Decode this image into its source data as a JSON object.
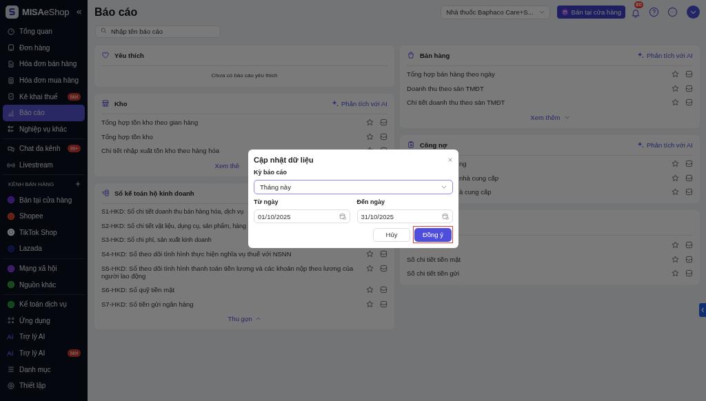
{
  "sidebar": {
    "logo": "**MISA**eShop",
    "sections": [
      {
        "items": [
          {
            "label": "Tổng quan",
            "kind": "nav",
            "selected": false
          },
          {
            "label": "Đơn hàng",
            "kind": "nav",
            "selected": false
          },
          {
            "label": "Hóa đơn bán hàng",
            "kind": "nav",
            "selected": false
          },
          {
            "label": "Hóa đơn mua hàng",
            "kind": "nav",
            "selected": false
          },
          {
            "label": "Kê khai thuế",
            "kind": "nav",
            "selected": false,
            "badge": "Mới"
          },
          {
            "label": "Báo cáo",
            "kind": "nav",
            "selected": true
          },
          {
            "label": "Nghiệp vụ khác",
            "kind": "nav",
            "selected": false
          }
        ]
      },
      {
        "items": [
          {
            "label": "Chat đa kênh",
            "kind": "nav",
            "selected": false,
            "badge": "99+"
          },
          {
            "label": "Livestream",
            "kind": "nav",
            "selected": false
          }
        ]
      },
      {
        "heading": "KÊNH BÁN HÀNG",
        "items": [
          {
            "label": "Bán tại cửa hàng",
            "kind": "channel",
            "selected": false
          },
          {
            "label": "Shopee",
            "kind": "channel",
            "selected": false
          },
          {
            "label": "TikTok Shop",
            "kind": "channel",
            "selected": false
          },
          {
            "label": "Lazada",
            "kind": "channel",
            "selected": false
          }
        ]
      },
      {
        "items": [
          {
            "label": "Mạng xã hội",
            "kind": "channel",
            "selected": false
          },
          {
            "label": "Nguồn khác",
            "kind": "channel",
            "selected": false
          }
        ]
      },
      {
        "items": [
          {
            "label": "Kế toán dịch vụ",
            "kind": "channel",
            "selected": false
          },
          {
            "label": "Ứng dụng",
            "kind": "nav",
            "selected": false
          },
          {
            "label": "Trợ lý AI",
            "kind": "ai",
            "icon_text": "Ai",
            "selected": false
          },
          {
            "label": "Trợ lý AI",
            "kind": "ai",
            "icon_text": "Ai",
            "selected": false,
            "badge": "Mới"
          },
          {
            "label": "Danh mục",
            "kind": "nav",
            "selected": false
          },
          {
            "label": "Thiết lập",
            "kind": "nav",
            "selected": false
          }
        ]
      }
    ]
  },
  "header": {
    "title": "Báo cáo",
    "store_select": "Nhà thuốc Baphaco Care+S...",
    "sell_button": "Bán tại cửa hàng",
    "notification_count": "80"
  },
  "search": {
    "placeholder": "Nhập tên báo cáo"
  },
  "columns": [
    [
      {
        "title": "Yêu thích",
        "empty": "Chưa có báo cáo yêu thích"
      },
      {
        "title": "Kho",
        "ai_link": "Phân tích với AI",
        "rows": [
          {
            "kind": "full",
            "label": "Tổng hợp tồn kho theo gian hàng"
          },
          {
            "kind": "full",
            "label": "Tổng hợp tồn kho"
          },
          {
            "kind": "full",
            "label": "Chi tiết nhập xuất tồn kho theo hàng hóa"
          }
        ],
        "more": {
          "label": "Xem thê",
          "kind": "cut"
        }
      },
      {
        "title": "Sổ kế toán hộ kinh doanh",
        "rows": [
          {
            "kind": "under",
            "label": "S1-HKD: Sổ chi tiết doanh thu bán hàng hóa, dịch vụ"
          },
          {
            "kind": "under",
            "label": "S2-HKD: Sổ chi tiết vật liệu, dụng cụ, sản phẩm, hàng"
          },
          {
            "kind": "under",
            "label": "S3-HKD: Sổ chi phí, sản xuất kinh doanh"
          },
          {
            "kind": "full",
            "label": "S4-HKD: Sổ theo dõi tình hình thực hiện nghĩa vụ thuế với NSNN"
          },
          {
            "kind": "full",
            "label": "S5-HKD: Sổ theo dõi tình hình thanh toán tiền lương và các khoản nộp theo lương của người lao động"
          },
          {
            "kind": "full",
            "label": "S6-HKD: Sổ quỹ tiền mặt"
          },
          {
            "kind": "full",
            "label": "S7-HKD: Sổ tiền gửi ngân hàng"
          }
        ],
        "more": {
          "label": "Thu gọn",
          "kind": "whole",
          "expanded": true
        }
      }
    ],
    [
      {
        "title": "Bán hàng",
        "ai_link": "Phân tích với AI",
        "rows": [
          {
            "kind": "full",
            "label": "Tổng hợp bán hàng theo ngày"
          },
          {
            "kind": "full",
            "label": "Doanh thu theo sàn TMĐT"
          },
          {
            "kind": "full",
            "label": "Chi tiết doanh thu theo sàn TMĐT"
          }
        ],
        "more": {
          "label": "Xem thêm",
          "kind": "whole",
          "expanded": false
        }
      },
      {
        "title": "Công nợ",
        "ai_link": "Phân tích với AI",
        "rows": [
          {
            "kind": "lead-cut",
            "label": "ng"
          },
          {
            "kind": "lead-cut",
            "label": "nhà cung cấp"
          },
          {
            "kind": "lead-cut",
            "label": "à cung cấp"
          }
        ]
      },
      {
        "rows": [
          {
            "kind": "icons-only"
          },
          {
            "kind": "full",
            "label": "Số chi tiết tiền mặt"
          },
          {
            "kind": "full",
            "label": "Số chi tiết tiền gửi"
          }
        ]
      }
    ]
  ],
  "dialog": {
    "title": "Cập nhật dữ liệu",
    "period_label": "Kỳ báo cáo",
    "period_value": "Tháng này",
    "from_label": "Từ ngày",
    "from_value": "01/10/2025",
    "to_label": "Đến ngày",
    "to_value": "31/10/2025",
    "buttons": [
      {
        "label": "Hủy",
        "kind": "secondary",
        "highlighted": false
      },
      {
        "label": "Đồng ý",
        "kind": "primary",
        "highlighted": true
      }
    ]
  }
}
